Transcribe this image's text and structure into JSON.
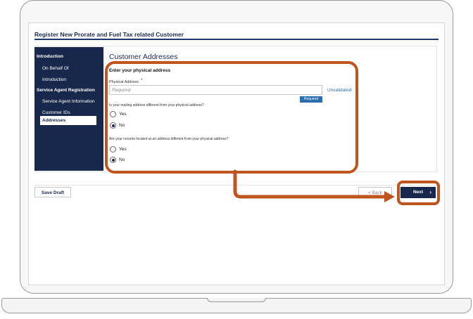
{
  "page": {
    "title": "Register New Prorate and Fuel Tax related Customer"
  },
  "sidebar": {
    "items": [
      {
        "label": "Introduction",
        "type": "section"
      },
      {
        "label": "On Behalf Of",
        "type": "sub"
      },
      {
        "label": "Introduction",
        "type": "sub"
      },
      {
        "label": "Service Agent Registration",
        "type": "section"
      },
      {
        "label": "Service Agent Information",
        "type": "sub"
      },
      {
        "label": "Customer IDs",
        "type": "sub"
      },
      {
        "label": "Addresses",
        "type": "sub",
        "active": true
      }
    ]
  },
  "main": {
    "heading": "Customer Addresses",
    "section_heading": "Enter your physical address",
    "physical_address": {
      "label": "Physical Address",
      "required_marker": "*",
      "placeholder": "Required",
      "value": "",
      "required_tag": "Required",
      "validation_status": "Unvalidated"
    },
    "question_mailing": {
      "text": "Is your mailing address different from your physical address?",
      "options": [
        "Yes",
        "No"
      ],
      "selected": "No"
    },
    "question_records": {
      "text": "Are your records located at an address different from your physical address?",
      "options": [
        "Yes",
        "No"
      ],
      "selected": "No"
    }
  },
  "footer": {
    "save_draft_label": "Save Draft",
    "back_label": "< Back",
    "next_label": "Next",
    "next_icon": "chevron-right-icon"
  },
  "colors": {
    "nav_dark": "#17284c",
    "accent_blue": "#2a6db0",
    "highlight_orange": "#c0541e"
  }
}
